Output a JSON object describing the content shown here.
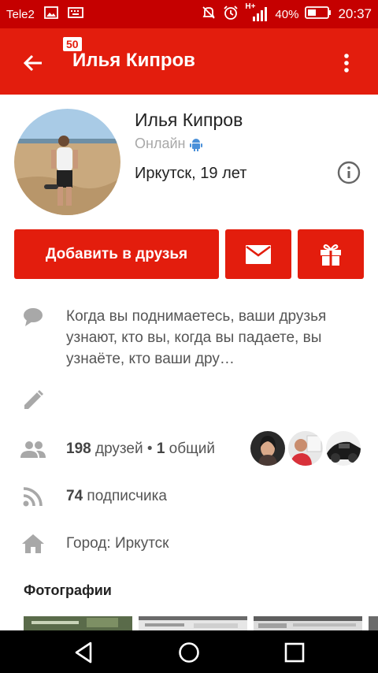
{
  "status_bar": {
    "carrier": "Tele2",
    "battery": "40%",
    "time": "20:37",
    "network": "H+"
  },
  "app_bar": {
    "title": "Илья Кипров",
    "badge": "50"
  },
  "profile": {
    "name": "Илья Кипров",
    "online": "Онлайн",
    "city_age": "Иркутск, 19 лет"
  },
  "actions": {
    "add_friend": "Добавить в друзья"
  },
  "status_text": "Когда вы поднимаетесь, ваши друзья узнают, кто вы, когда вы падаете, вы узнаёте, кто ваши дру…",
  "friends": {
    "count": "198",
    "count_label": " друзей • ",
    "mutual": "1",
    "mutual_label": " общий"
  },
  "subscribers": {
    "count": "74",
    "label": " подписчика"
  },
  "city": "Город: Иркутск",
  "photos_title": "Фотографии",
  "colors": {
    "accent": "#e31d0d",
    "status_bar": "#c50000"
  }
}
